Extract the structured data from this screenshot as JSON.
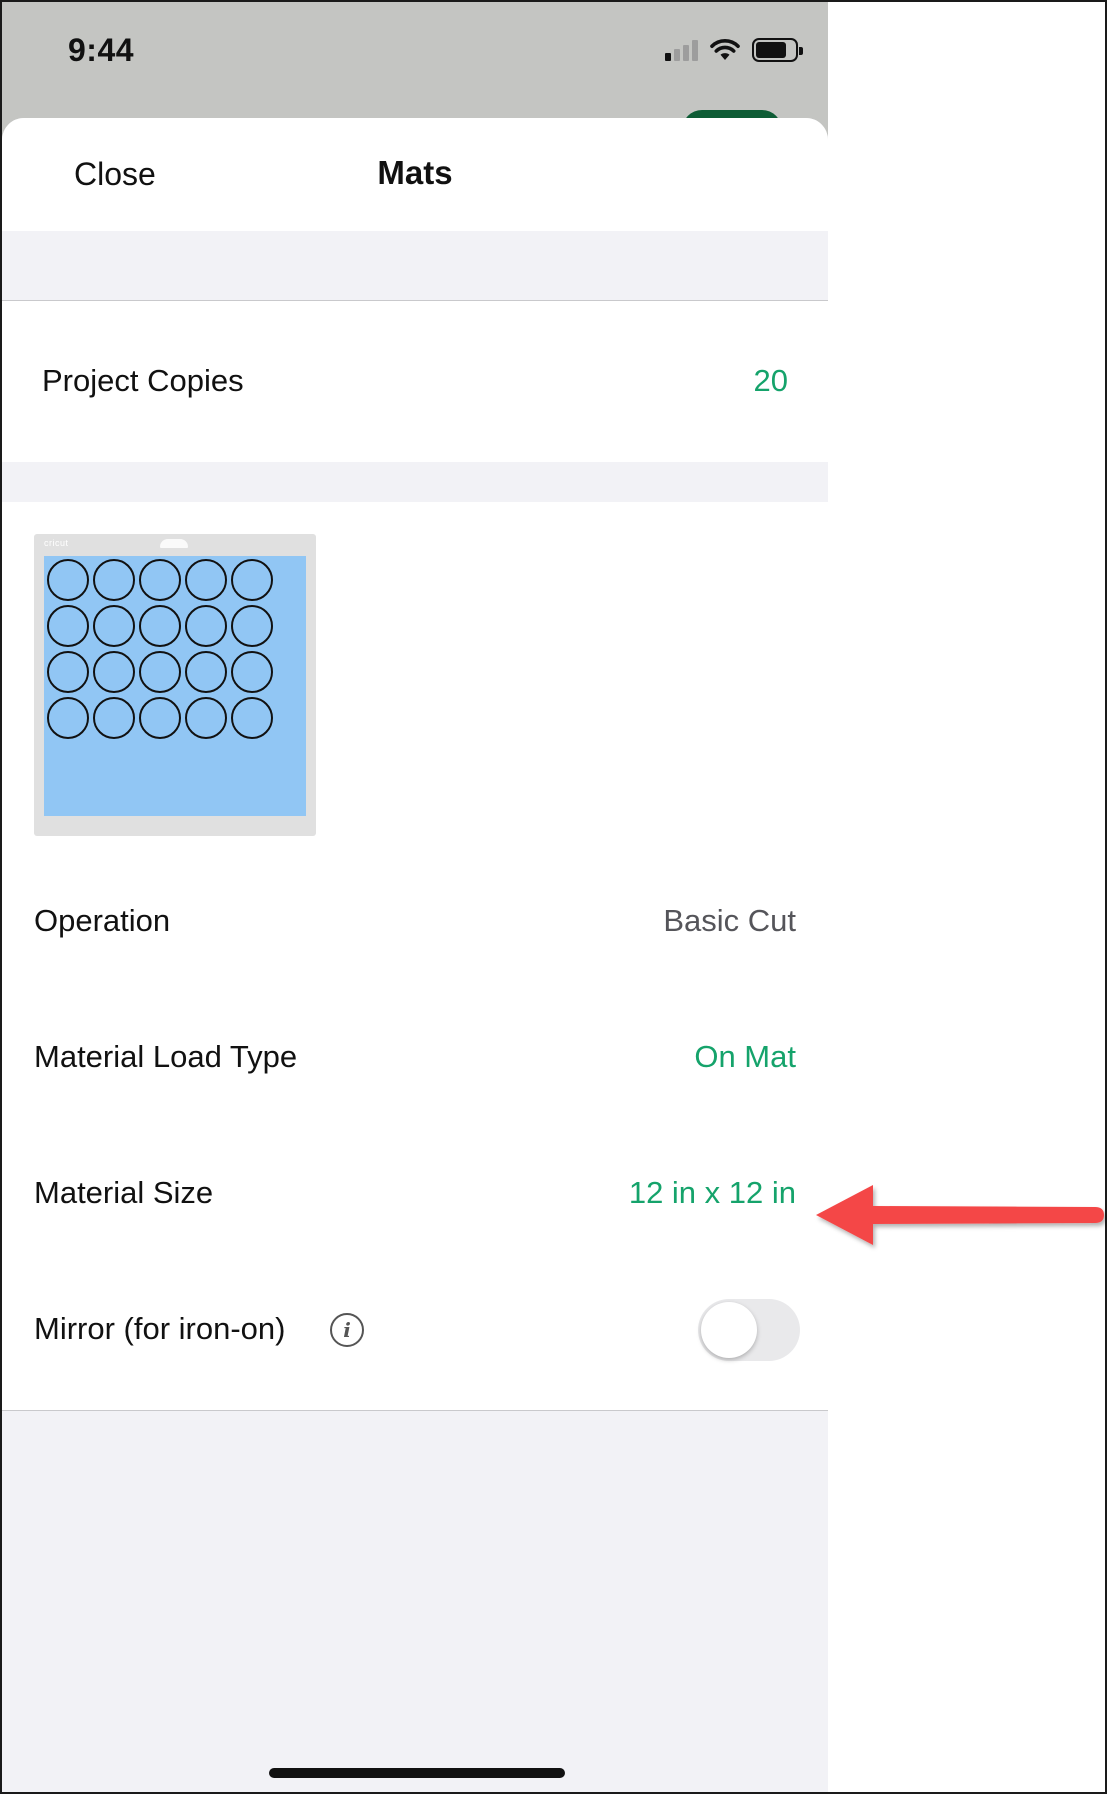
{
  "status_bar": {
    "time": "9:44"
  },
  "header": {
    "close_label": "Close",
    "title": "Mats"
  },
  "project_copies": {
    "label": "Project Copies",
    "value": "20"
  },
  "mat": {
    "logo": "cricut",
    "copies_shown": 20
  },
  "settings": {
    "operation": {
      "label": "Operation",
      "value": "Basic Cut"
    },
    "material_load_type": {
      "label": "Material Load Type",
      "value": "On Mat"
    },
    "material_size": {
      "label": "Material Size",
      "value": "12 in x 12 in"
    },
    "mirror": {
      "label": "Mirror (for iron-on)",
      "info_icon": "i",
      "enabled": false
    }
  },
  "colors": {
    "accent_green": "#15a36b",
    "annotation_red": "#f44747",
    "mat_blue": "#91c6f4"
  },
  "icons": [
    "cellular-signal-icon",
    "wifi-icon",
    "battery-icon",
    "info-icon",
    "arrow-annotation-icon"
  ]
}
